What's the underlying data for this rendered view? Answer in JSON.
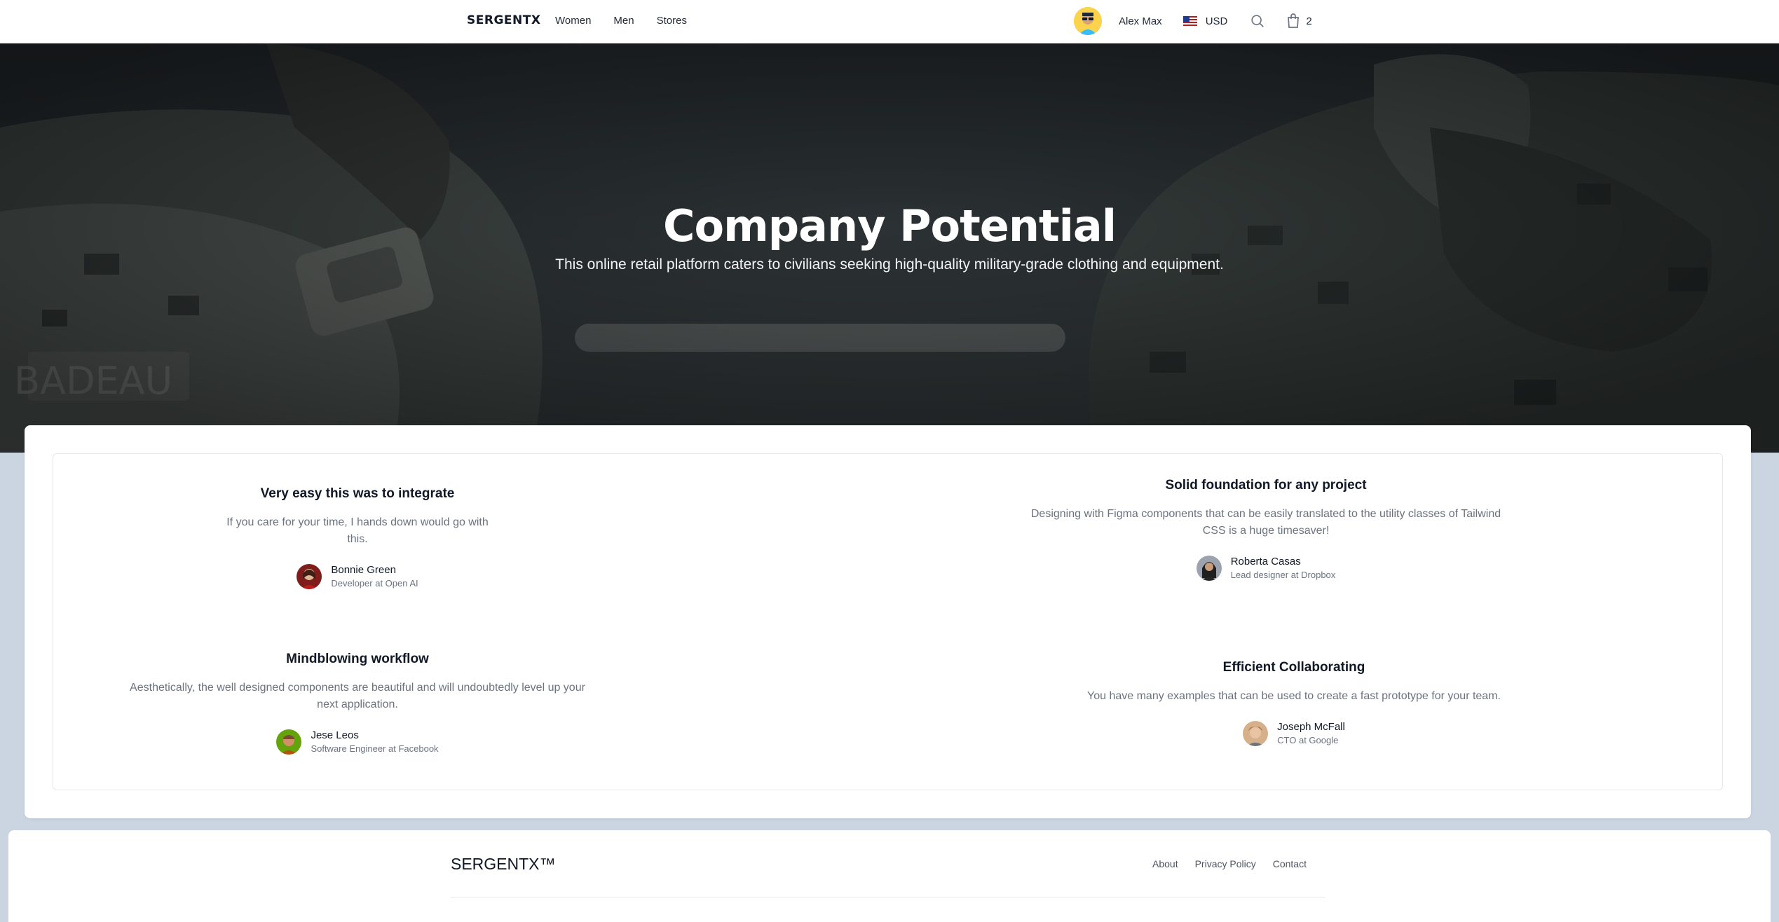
{
  "nav": {
    "logo": "SERGENTX",
    "links": [
      "Women",
      "Men",
      "Stores"
    ],
    "user_name": "Alex Max",
    "currency": "USD",
    "cart_count": "2"
  },
  "hero": {
    "title": "Company Potential",
    "subtitle": "This online retail platform caters to civilians seeking high-quality military-grade clothing and equipment."
  },
  "testimonials": [
    {
      "title": "Very easy this was to integrate",
      "body": "If you care for your time, I hands down would go with this.",
      "name": "Bonnie Green",
      "role": "Developer at Open AI"
    },
    {
      "title": "Solid foundation for any project",
      "body": "Designing with Figma components that can be easily translated to the utility classes of Tailwind CSS is a huge timesaver!",
      "name": "Roberta Casas",
      "role": "Lead designer at Dropbox"
    },
    {
      "title": "Mindblowing workflow",
      "body": "Aesthetically, the well designed components are beautiful and will undoubtedly level up your next application.",
      "name": "Jese Leos",
      "role": "Software Engineer at Facebook"
    },
    {
      "title": "Efficient Collaborating",
      "body": "You have many examples that can be used to create a fast prototype for your team.",
      "name": "Joseph McFall",
      "role": "CTO at Google"
    }
  ],
  "footer": {
    "brand": "SERGENTX™",
    "links": [
      "About",
      "Privacy Policy",
      "Contact"
    ]
  },
  "icons": {
    "search": "search-icon",
    "cart": "shopping-bag-icon",
    "flag": "us-flag-icon"
  },
  "colors": {
    "page_bg": "#cbd5e1",
    "text_primary": "#111827",
    "text_muted": "#6b7280"
  }
}
